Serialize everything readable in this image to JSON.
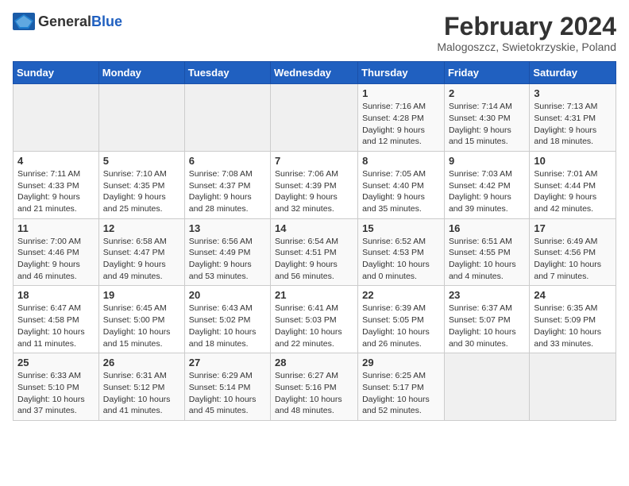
{
  "header": {
    "logo_general": "General",
    "logo_blue": "Blue",
    "title": "February 2024",
    "subtitle": "Malogoszcz, Swietokrzyskie, Poland"
  },
  "weekdays": [
    "Sunday",
    "Monday",
    "Tuesday",
    "Wednesday",
    "Thursday",
    "Friday",
    "Saturday"
  ],
  "weeks": [
    [
      {
        "day": "",
        "info": ""
      },
      {
        "day": "",
        "info": ""
      },
      {
        "day": "",
        "info": ""
      },
      {
        "day": "",
        "info": ""
      },
      {
        "day": "1",
        "info": "Sunrise: 7:16 AM\nSunset: 4:28 PM\nDaylight: 9 hours\nand 12 minutes."
      },
      {
        "day": "2",
        "info": "Sunrise: 7:14 AM\nSunset: 4:30 PM\nDaylight: 9 hours\nand 15 minutes."
      },
      {
        "day": "3",
        "info": "Sunrise: 7:13 AM\nSunset: 4:31 PM\nDaylight: 9 hours\nand 18 minutes."
      }
    ],
    [
      {
        "day": "4",
        "info": "Sunrise: 7:11 AM\nSunset: 4:33 PM\nDaylight: 9 hours\nand 21 minutes."
      },
      {
        "day": "5",
        "info": "Sunrise: 7:10 AM\nSunset: 4:35 PM\nDaylight: 9 hours\nand 25 minutes."
      },
      {
        "day": "6",
        "info": "Sunrise: 7:08 AM\nSunset: 4:37 PM\nDaylight: 9 hours\nand 28 minutes."
      },
      {
        "day": "7",
        "info": "Sunrise: 7:06 AM\nSunset: 4:39 PM\nDaylight: 9 hours\nand 32 minutes."
      },
      {
        "day": "8",
        "info": "Sunrise: 7:05 AM\nSunset: 4:40 PM\nDaylight: 9 hours\nand 35 minutes."
      },
      {
        "day": "9",
        "info": "Sunrise: 7:03 AM\nSunset: 4:42 PM\nDaylight: 9 hours\nand 39 minutes."
      },
      {
        "day": "10",
        "info": "Sunrise: 7:01 AM\nSunset: 4:44 PM\nDaylight: 9 hours\nand 42 minutes."
      }
    ],
    [
      {
        "day": "11",
        "info": "Sunrise: 7:00 AM\nSunset: 4:46 PM\nDaylight: 9 hours\nand 46 minutes."
      },
      {
        "day": "12",
        "info": "Sunrise: 6:58 AM\nSunset: 4:47 PM\nDaylight: 9 hours\nand 49 minutes."
      },
      {
        "day": "13",
        "info": "Sunrise: 6:56 AM\nSunset: 4:49 PM\nDaylight: 9 hours\nand 53 minutes."
      },
      {
        "day": "14",
        "info": "Sunrise: 6:54 AM\nSunset: 4:51 PM\nDaylight: 9 hours\nand 56 minutes."
      },
      {
        "day": "15",
        "info": "Sunrise: 6:52 AM\nSunset: 4:53 PM\nDaylight: 10 hours\nand 0 minutes."
      },
      {
        "day": "16",
        "info": "Sunrise: 6:51 AM\nSunset: 4:55 PM\nDaylight: 10 hours\nand 4 minutes."
      },
      {
        "day": "17",
        "info": "Sunrise: 6:49 AM\nSunset: 4:56 PM\nDaylight: 10 hours\nand 7 minutes."
      }
    ],
    [
      {
        "day": "18",
        "info": "Sunrise: 6:47 AM\nSunset: 4:58 PM\nDaylight: 10 hours\nand 11 minutes."
      },
      {
        "day": "19",
        "info": "Sunrise: 6:45 AM\nSunset: 5:00 PM\nDaylight: 10 hours\nand 15 minutes."
      },
      {
        "day": "20",
        "info": "Sunrise: 6:43 AM\nSunset: 5:02 PM\nDaylight: 10 hours\nand 18 minutes."
      },
      {
        "day": "21",
        "info": "Sunrise: 6:41 AM\nSunset: 5:03 PM\nDaylight: 10 hours\nand 22 minutes."
      },
      {
        "day": "22",
        "info": "Sunrise: 6:39 AM\nSunset: 5:05 PM\nDaylight: 10 hours\nand 26 minutes."
      },
      {
        "day": "23",
        "info": "Sunrise: 6:37 AM\nSunset: 5:07 PM\nDaylight: 10 hours\nand 30 minutes."
      },
      {
        "day": "24",
        "info": "Sunrise: 6:35 AM\nSunset: 5:09 PM\nDaylight: 10 hours\nand 33 minutes."
      }
    ],
    [
      {
        "day": "25",
        "info": "Sunrise: 6:33 AM\nSunset: 5:10 PM\nDaylight: 10 hours\nand 37 minutes."
      },
      {
        "day": "26",
        "info": "Sunrise: 6:31 AM\nSunset: 5:12 PM\nDaylight: 10 hours\nand 41 minutes."
      },
      {
        "day": "27",
        "info": "Sunrise: 6:29 AM\nSunset: 5:14 PM\nDaylight: 10 hours\nand 45 minutes."
      },
      {
        "day": "28",
        "info": "Sunrise: 6:27 AM\nSunset: 5:16 PM\nDaylight: 10 hours\nand 48 minutes."
      },
      {
        "day": "29",
        "info": "Sunrise: 6:25 AM\nSunset: 5:17 PM\nDaylight: 10 hours\nand 52 minutes."
      },
      {
        "day": "",
        "info": ""
      },
      {
        "day": "",
        "info": ""
      }
    ]
  ]
}
